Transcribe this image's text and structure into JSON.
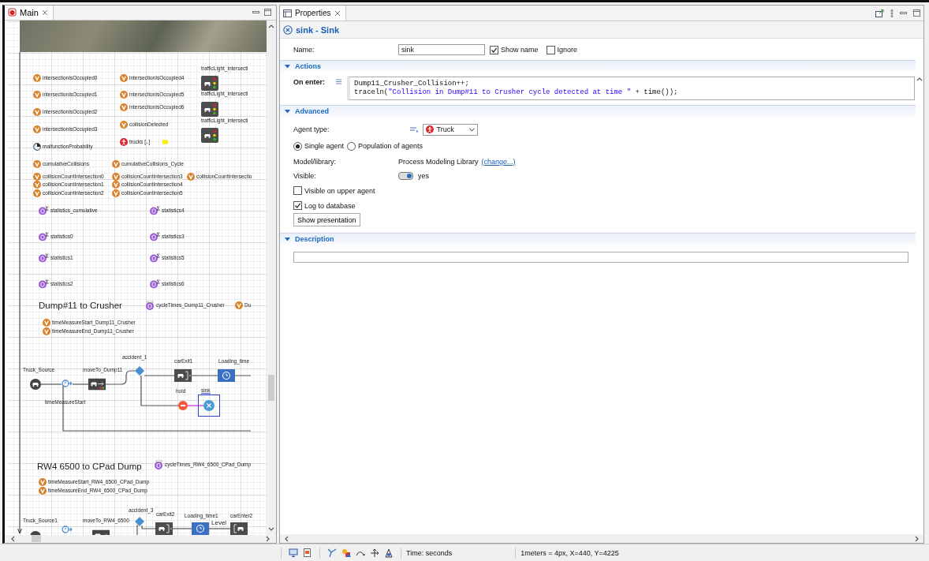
{
  "left_panel": {
    "tab": {
      "label": "Main",
      "selected": true
    },
    "canvas": {
      "items": [
        {
          "kind": "variable",
          "label": "intersectionIsOccupied0",
          "selected": false
        },
        {
          "kind": "variable",
          "label": "intersectionIsOccupied1",
          "selected": false
        },
        {
          "kind": "variable",
          "label": "intersectionIsOccupied2",
          "selected": false
        },
        {
          "kind": "variable",
          "label": "intersectionIsOccupied3",
          "selected": false
        },
        {
          "kind": "parameter",
          "label": "malfunctionProbability",
          "selected": false
        },
        {
          "kind": "variable",
          "label": "intersectionIsOccupied4",
          "selected": false
        },
        {
          "kind": "variable",
          "label": "intersectionIsOccupied5",
          "selected": false
        },
        {
          "kind": "variable",
          "label": "intersectionIsOccupied6",
          "selected": false
        },
        {
          "kind": "variable",
          "label": "collisionDetected",
          "selected": false
        },
        {
          "kind": "population",
          "label": "trucks [..]",
          "selected": false
        },
        {
          "kind": "traffic-light",
          "label": "trafficLight_intersecti",
          "selected": false
        },
        {
          "kind": "traffic-light",
          "label": "trafficLight_intersecti",
          "selected": false
        },
        {
          "kind": "traffic-light",
          "label": "trafficLight_intersecti",
          "selected": false
        },
        {
          "kind": "variable",
          "label": "cumulativeCollisions",
          "selected": false
        },
        {
          "kind": "variable",
          "label": "cumulativeCollisions_Cycle",
          "selected": false
        },
        {
          "kind": "variable",
          "label": "collisionCountIntersection0",
          "selected": false
        },
        {
          "kind": "variable",
          "label": "collisionCountIntersection1",
          "selected": false
        },
        {
          "kind": "variable",
          "label": "collisionCountIntersection2",
          "selected": false
        },
        {
          "kind": "variable",
          "label": "collisionCountIntersection3",
          "selected": false
        },
        {
          "kind": "variable",
          "label": "collisionCountIntersection4",
          "selected": false
        },
        {
          "kind": "variable",
          "label": "collisionCountIntersection5",
          "selected": false
        },
        {
          "kind": "variable",
          "label": "collisionCountIntersectio",
          "selected": false
        },
        {
          "kind": "statistics",
          "label": "statistics_cumulative",
          "selected": false
        },
        {
          "kind": "statistics",
          "label": "statistics4",
          "selected": false
        },
        {
          "kind": "statistics",
          "label": "statistics0",
          "selected": false
        },
        {
          "kind": "statistics",
          "label": "statistics3",
          "selected": false
        },
        {
          "kind": "statistics",
          "label": "statistics1",
          "selected": false
        },
        {
          "kind": "statistics",
          "label": "statistics5",
          "selected": false
        },
        {
          "kind": "statistics",
          "label": "statistics2",
          "selected": false
        },
        {
          "kind": "statistics",
          "label": "statistics6",
          "selected": false
        },
        {
          "kind": "heading",
          "label": "Dump#11 to Crusher",
          "selected": false
        },
        {
          "kind": "dataset",
          "label": "cycleTimes_Dump11_Crusher",
          "selected": false
        },
        {
          "kind": "variable",
          "label": "Du",
          "selected": false
        },
        {
          "kind": "variable",
          "label": "timeMeasureStart_Dump11_Crusher",
          "selected": false
        },
        {
          "kind": "variable",
          "label": "timeMeasureEnd_Dump11_Crusher",
          "selected": false
        },
        {
          "kind": "source",
          "label": "Truck_Source",
          "selected": false
        },
        {
          "kind": "time-measure-start",
          "label": "timeMeasureStart",
          "selected": false
        },
        {
          "kind": "move-to",
          "label": "moveTo_Dump11",
          "selected": false
        },
        {
          "kind": "select-output",
          "label": "accident_1",
          "selected": false
        },
        {
          "kind": "car-exit",
          "label": "carExit1",
          "selected": false
        },
        {
          "kind": "delay",
          "label": "Loading_time",
          "selected": false
        },
        {
          "kind": "hold",
          "label": "hold",
          "selected": false
        },
        {
          "kind": "sink",
          "label": "sink",
          "selected": true
        },
        {
          "kind": "heading",
          "label": "RW4 6500 to CPad Dump",
          "selected": false
        },
        {
          "kind": "dataset",
          "label": "cycleTimes_RW4_6500_CPad_Dump",
          "selected": false
        },
        {
          "kind": "variable",
          "label": "timeMeasureStart_RW4_6500_CPad_Dump",
          "selected": false
        },
        {
          "kind": "variable",
          "label": "timeMeasureEnd_RW4_6500_CPad_Dump",
          "selected": false
        },
        {
          "kind": "source",
          "label": "Truck_Source1",
          "selected": false
        },
        {
          "kind": "time-measure-start",
          "selected": false
        },
        {
          "kind": "move-to",
          "label": "moveTo_RW4_6500",
          "selected": false
        },
        {
          "kind": "select-output",
          "label": "accident_3",
          "selected": false
        },
        {
          "kind": "car-exit",
          "label": "carExit2",
          "selected": false
        },
        {
          "kind": "delay",
          "label": "Loading_time1",
          "selected": false
        },
        {
          "kind": "car-enter",
          "label": "carEnter2",
          "selected": false
        },
        {
          "kind": "text",
          "label": "Level",
          "selected": false
        }
      ]
    }
  },
  "properties": {
    "tab": {
      "label": "Properties",
      "selected": true
    },
    "title": "sink - Sink",
    "name": {
      "label": "Name:",
      "value": "sink"
    },
    "show_name": {
      "label": "Show name",
      "checked": true
    },
    "ignore": {
      "label": "Ignore",
      "checked": false
    },
    "actions": {
      "title": "Actions",
      "expanded": true,
      "on_enter_label": "On enter:",
      "code_lines": [
        [
          {
            "kind": "plain",
            "text": "Dump11_Crusher_Collision++;"
          }
        ],
        [
          {
            "kind": "plain",
            "text": "traceln("
          },
          {
            "kind": "string",
            "text": "\"Collision in Dump#11 to Crusher cycle detected at time \""
          },
          {
            "kind": "plain",
            "text": " + time());"
          }
        ]
      ]
    },
    "advanced": {
      "title": "Advanced",
      "expanded": true,
      "agent_type_label": "Agent type:",
      "agent_type": "Truck",
      "radios": [
        {
          "label": "Single agent",
          "selected": true
        },
        {
          "label": "Population of agents",
          "selected": false
        }
      ],
      "model_library_label": "Model/library:",
      "model_library": "Process Modeling Library",
      "change_link": "(change...)",
      "visible_label": "Visible:",
      "visible": {
        "on": true,
        "text": "yes"
      },
      "checkboxes": [
        {
          "label": "Visible on upper agent",
          "checked": false
        },
        {
          "label": "Log to database",
          "checked": true
        }
      ],
      "button": "Show presentation"
    },
    "description": {
      "title": "Description",
      "expanded": true
    }
  },
  "status_bar": {
    "time_units": "Time: seconds",
    "coordinates": "1meters = 4px, X=440, Y=4225"
  }
}
